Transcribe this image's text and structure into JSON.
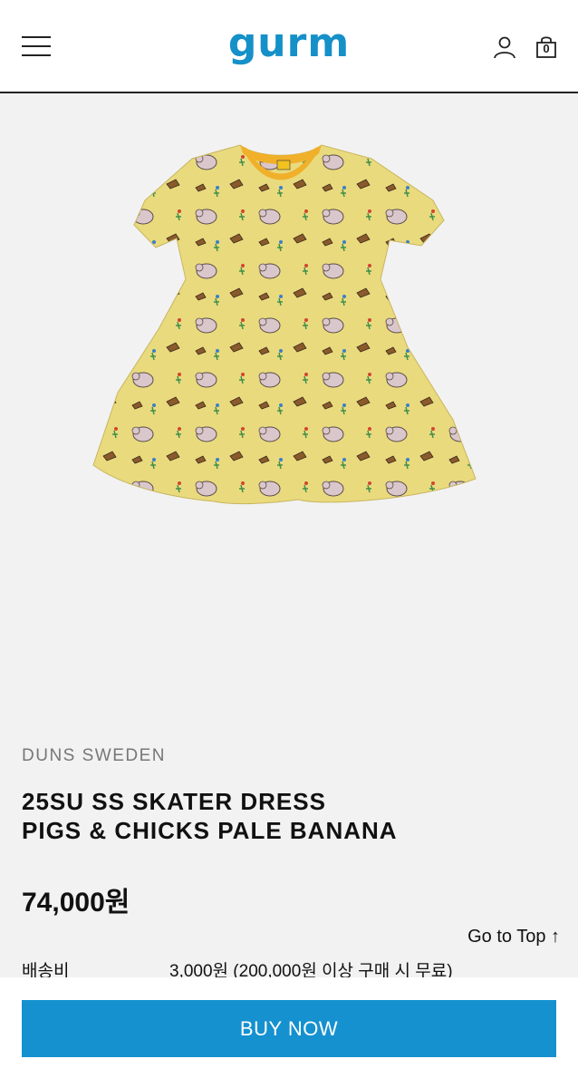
{
  "header": {
    "logo_text": "gurm",
    "menu_icon": "hamburger-menu-icon",
    "account_icon": "user-icon",
    "cart_icon": "shopping-bag-icon",
    "cart_count": "0",
    "brand_color": "#1590c8"
  },
  "product": {
    "image_icon": "dress-image",
    "brand": "DUNS SWEDEN",
    "title_line1": "25SU SS SKATER DRESS",
    "title_line2": "PIGS & CHICKS PALE BANANA",
    "price": "74,000원",
    "label_text": "DUNS"
  },
  "scroll": {
    "go_top_label": "Go to Top ↑"
  },
  "shipping": {
    "label": "배송비",
    "value": "3,000원 (200,000원 이상 구매 시 무료)"
  },
  "cta": {
    "buy_label": "BUY NOW",
    "buy_color": "#1591cf"
  }
}
